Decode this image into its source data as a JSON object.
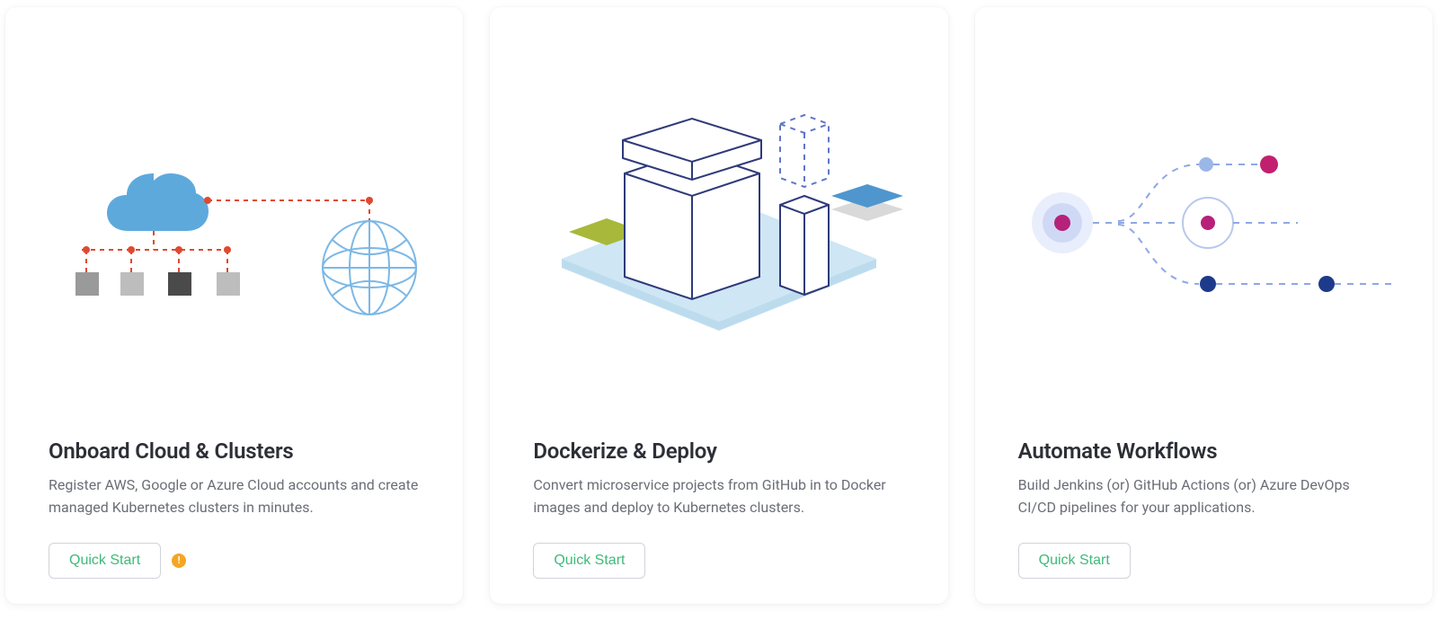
{
  "cards": [
    {
      "title": "Onboard Cloud & Clusters",
      "desc": "Register AWS, Google or Azure Cloud accounts and create managed Kubernetes clusters in minutes.",
      "button": "Quick Start",
      "alert": "!"
    },
    {
      "title": "Dockerize & Deploy",
      "desc": "Convert microservice projects from GitHub in to Docker images and deploy to Kubernetes clusters.",
      "button": "Quick Start"
    },
    {
      "title": "Automate Workflows",
      "desc": "Build Jenkins (or) GitHub Actions (or) Azure DevOps CI/CD pipelines for your applications.",
      "button": "Quick Start"
    }
  ]
}
